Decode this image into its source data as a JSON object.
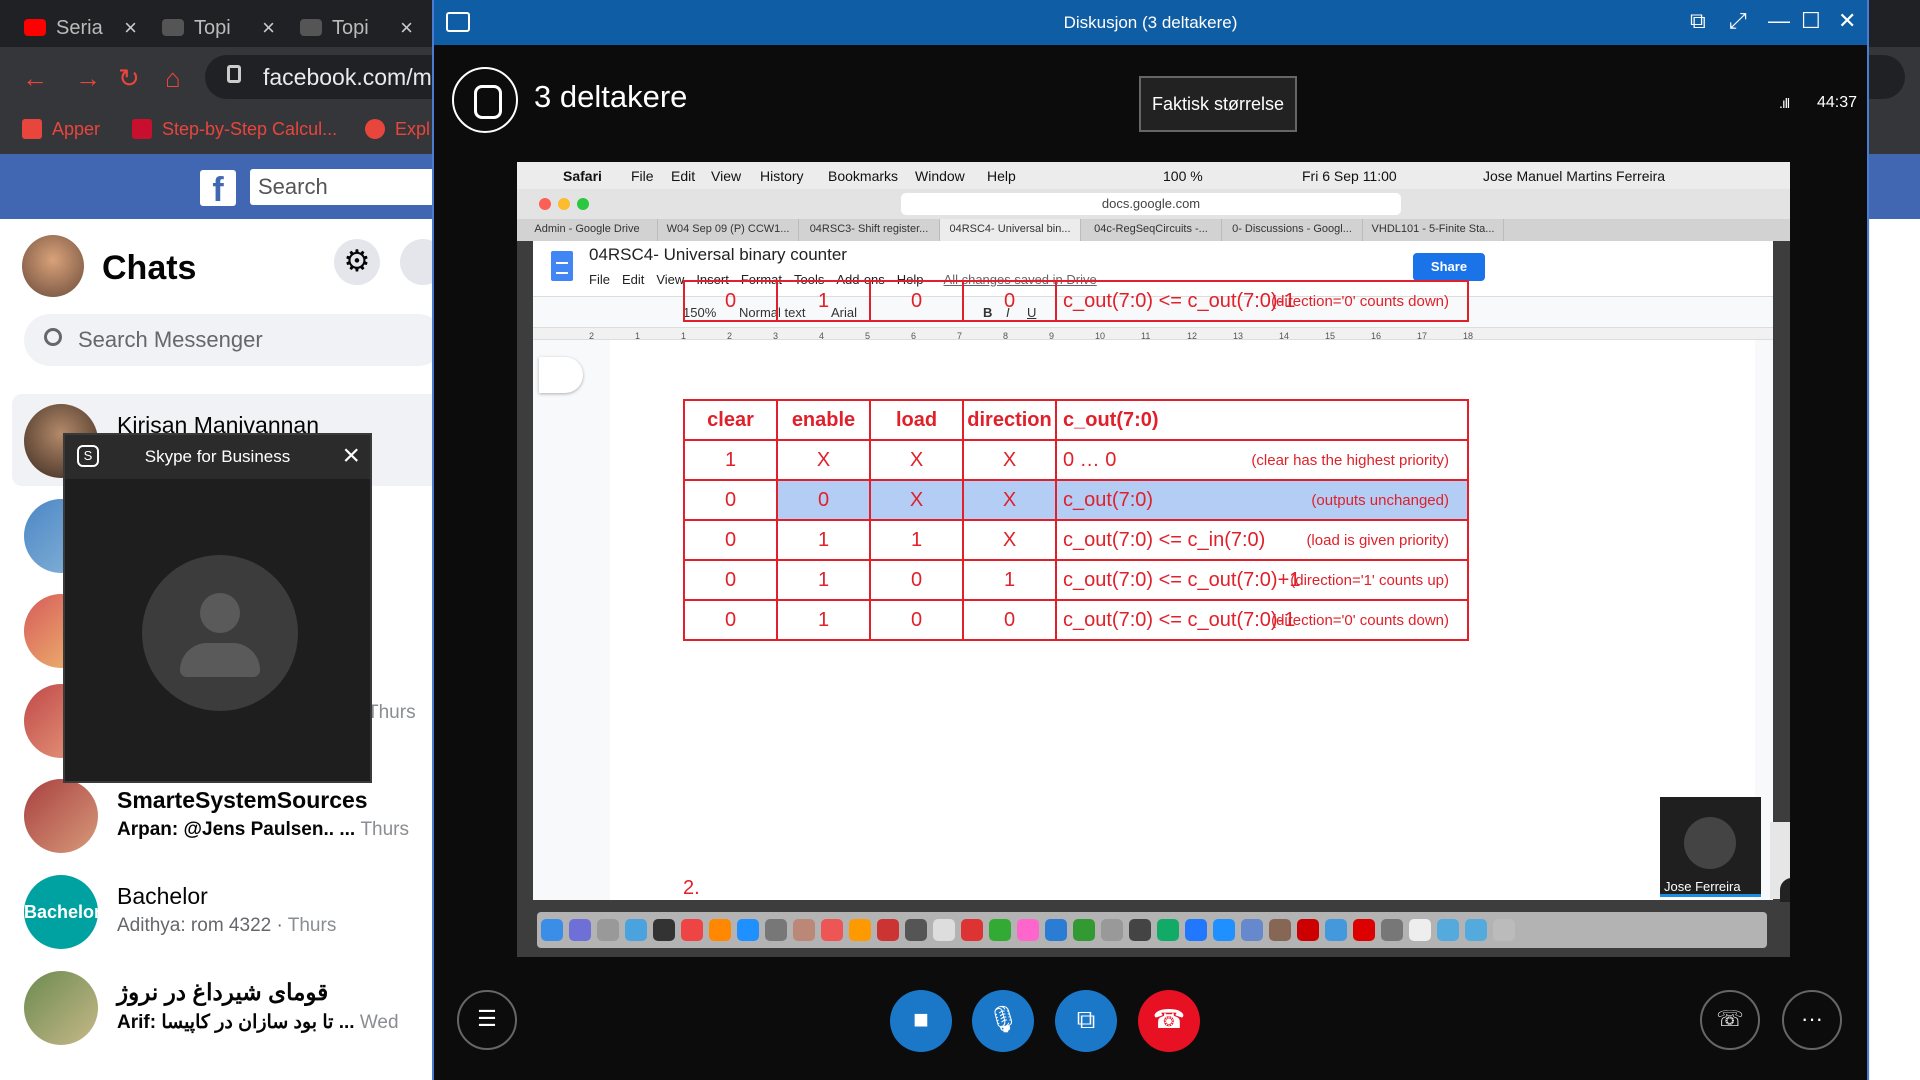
{
  "browser": {
    "tabs": [
      {
        "label": "Seria",
        "color": "#ff0000"
      },
      {
        "label": "Topi",
        "color": "#444"
      },
      {
        "label": "Topi",
        "color": "#444"
      }
    ],
    "url": "facebook.com/messages",
    "bookmarks": [
      {
        "label": "Apper",
        "color": "#e8453c"
      },
      {
        "label": "Step-by-Step Calcul...",
        "color": "#c8102e"
      },
      {
        "label": "Expl",
        "color": "#e8453c"
      }
    ]
  },
  "facebook": {
    "search_placeholder": "Search",
    "chats_title": "Chats",
    "messenger_search_placeholder": "Search Messenger",
    "chats": [
      {
        "name": "Kirisan Manivannan",
        "sub": "",
        "time": "",
        "bold": false
      },
      {
        "name": "",
        "sub": "",
        "time": "Thurs",
        "bold": false
      },
      {
        "name": "SmarteSystemSources",
        "sub": "Arpan: @Jens Paulsen.. ...",
        "time": "Thurs",
        "bold": true
      },
      {
        "name": "Bachelor",
        "sub": "Adithya: rom 4322",
        "time": "Thurs",
        "bold": false,
        "avatar_text": "Bachelor"
      },
      {
        "name": "قومای شیرداغ در نروژ",
        "sub": "Arif: تا بود سازان در کاپیسا ...",
        "time": "Wed",
        "bold": true
      }
    ]
  },
  "skype_popup": {
    "title": "Skype for Business"
  },
  "skype": {
    "window_title": "Diskusjon (3 deltakere)",
    "participants_title": "3 deltakere",
    "tooltip": "Faktisk størrelse",
    "call_time": "44:37",
    "accent": "#0f5da4"
  },
  "shared": {
    "mac_menu": [
      "Safari",
      "File",
      "Edit",
      "View",
      "History",
      "Bookmarks",
      "Window",
      "Help"
    ],
    "mac_status": {
      "battery": "100 %",
      "datetime": "Fri 6 Sep 11:00",
      "user": "Jose Manuel Martins Ferreira"
    },
    "url": "docs.google.com",
    "safari_tabs": [
      {
        "label": "Admin - Google Drive",
        "active": false
      },
      {
        "label": "W04 Sep 09 (P) CCW1...",
        "active": false
      },
      {
        "label": "04RSC3- Shift register...",
        "active": false
      },
      {
        "label": "04RSC4- Universal bin...",
        "active": true
      },
      {
        "label": "04c-RegSeqCircuits -...",
        "active": false
      },
      {
        "label": "0- Discussions - Googl...",
        "active": false
      },
      {
        "label": "VHDL101 - 5-Finite Sta...",
        "active": false
      }
    ],
    "doc_title": "04RSC4- Universal binary counter",
    "doc_menu": [
      "File",
      "Edit",
      "View",
      "Insert",
      "Format",
      "Tools",
      "Add-ons",
      "Help"
    ],
    "saved_status": "All changes saved in Drive",
    "share_label": "Share",
    "toolbar": {
      "zoom": "150%",
      "style": "Normal text",
      "font": "Arial"
    },
    "ruler_ticks": [
      "2",
      "1",
      "1",
      "2",
      "3",
      "4",
      "5",
      "6",
      "7",
      "8",
      "9",
      "10",
      "11",
      "12",
      "13",
      "14",
      "15",
      "16",
      "17",
      "18"
    ],
    "top_row": [
      "0",
      "1",
      "0",
      "0",
      "c_out(7:0) <= c_out(7:0)-1",
      "(direction='0' counts down)"
    ],
    "table": {
      "headers": [
        "clear",
        "enable",
        "load",
        "direction",
        "c_out(7:0)"
      ],
      "rows": [
        {
          "cells": [
            "1",
            "X",
            "X",
            "X",
            "0 … 0"
          ],
          "note": "(clear has the highest priority)",
          "selected": false
        },
        {
          "cells": [
            "0",
            "0",
            "X",
            "X",
            "c_out(7:0)"
          ],
          "note": "(outputs unchanged)",
          "selected": true
        },
        {
          "cells": [
            "0",
            "1",
            "1",
            "X",
            "c_out(7:0) <= c_in(7:0)"
          ],
          "note": "(load is given priority)",
          "selected": false
        },
        {
          "cells": [
            "0",
            "1",
            "0",
            "1",
            "c_out(7:0) <= c_out(7:0)+1"
          ],
          "note": "(direction='1' counts up)",
          "selected": false
        },
        {
          "cells": [
            "0",
            "1",
            "0",
            "0",
            "c_out(7:0) <= c_out(7:0)-1"
          ],
          "note": "(direction='0' counts down)",
          "selected": false
        }
      ]
    },
    "next_heading": "2.",
    "presenter_name": "Jose Ferreira",
    "table_color": "#e0202a"
  }
}
